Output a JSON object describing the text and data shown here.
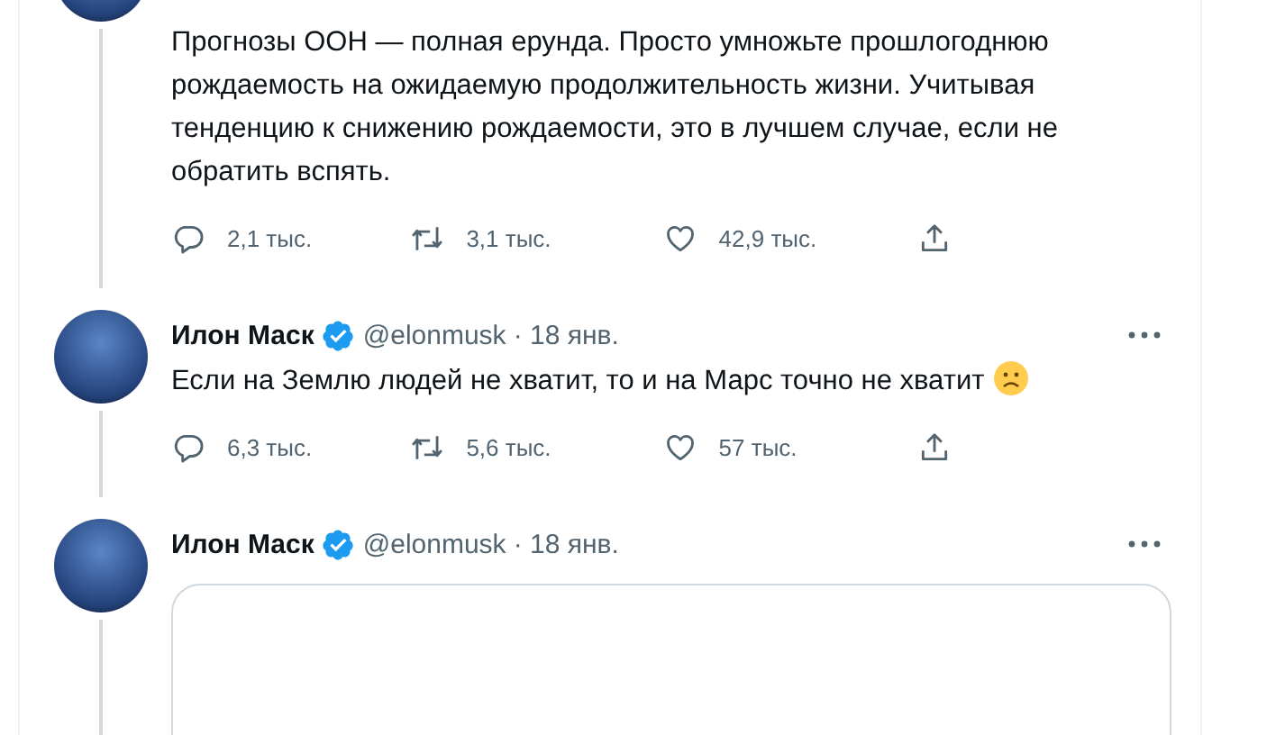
{
  "tweets": [
    {
      "kind": "text",
      "text": "Прогнозы ООН — полная ерунда. Просто умножьте прошлогоднюю рождаемость на ожидаемую продолжительность жизни. Учитывая тенденцию к снижению рождаемости, это в лучшем случае, если не обратить вспять.",
      "stats": {
        "replies": "2,1 тыс.",
        "retweets": "3,1 тыс.",
        "likes": "42,9 тыс."
      }
    },
    {
      "kind": "text",
      "name": "Илон Маск",
      "verified": true,
      "handle": "@elonmusk",
      "date": "· 18 янв.",
      "text": "Если на Землю людей не хватит, то и на Марс точно не хватит",
      "emoji": true,
      "stats": {
        "replies": "6,3 тыс.",
        "retweets": "5,6 тыс.",
        "likes": "57 тыс."
      }
    },
    {
      "kind": "media",
      "name": "Илон Маск",
      "verified": true,
      "handle": "@elonmusk",
      "date": "· 18 янв."
    }
  ]
}
